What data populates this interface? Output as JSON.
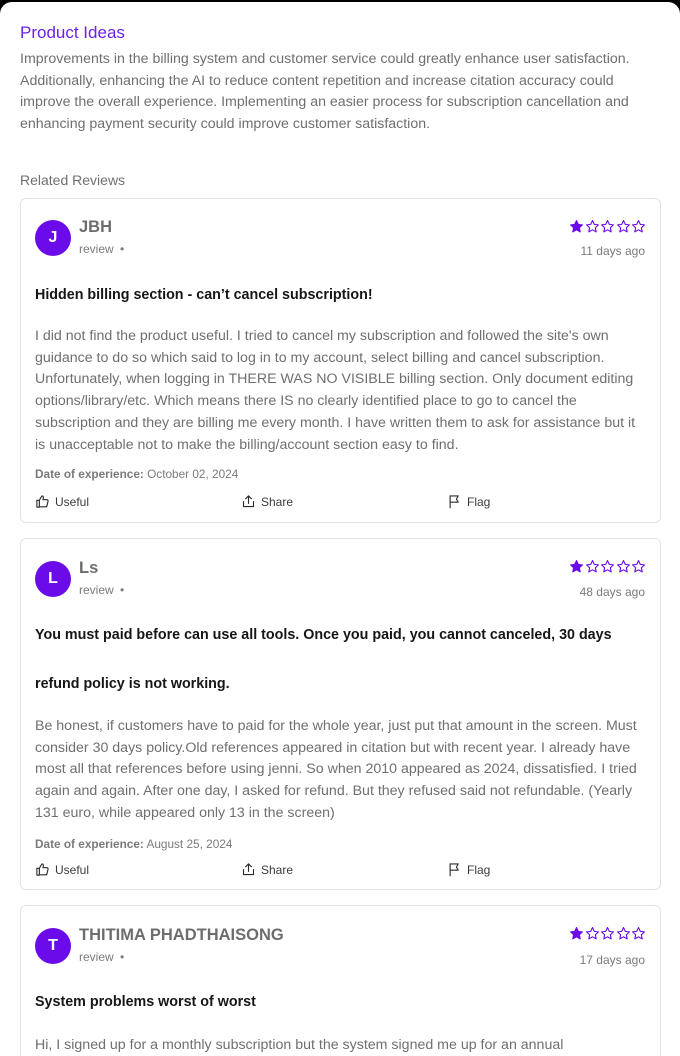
{
  "product_ideas": {
    "title": "Product Ideas",
    "text": "Improvements in the billing system and customer service could greatly enhance user satisfaction. Additionally, enhancing the AI to reduce content repetition and increase citation accuracy could improve the overall experience. Implementing an easier process for subscription cancellation and enhancing payment security could improve customer satisfaction."
  },
  "related_reviews": {
    "title": "Related Reviews",
    "colors": {
      "accent": "#6b0bea",
      "text_muted": "#6f6f6f"
    },
    "max_stars": 5,
    "actions": {
      "useful": "Useful",
      "share": "Share",
      "flag": "Flag"
    },
    "doe_label": "Date of experience:",
    "reviews": [
      {
        "initial": "J",
        "name": "JBH",
        "type": "review",
        "separator": "•",
        "rating": 1,
        "ago": "11 days ago",
        "title": "Hidden billing section - can’t cancel subscription!",
        "body": "I did not find the product useful. I tried to cancel my subscription and followed the site's own guidance to do so which said to log in to my account, select billing and cancel subscription. Unfortunately, when logging in THERE WAS NO VISIBLE billing section. Only document editing options/library/etc. Which means there IS no clearly identified place to go to cancel the subscription and they are billing me every month. I have written them to ask for assistance but it is unacceptable not to make the billing/account section easy to find.",
        "date": "October 02, 2024"
      },
      {
        "initial": "L",
        "name": "Ls",
        "type": "review",
        "separator": "•",
        "rating": 1,
        "ago": "48 days ago",
        "title": "You must paid before can use all tools. Once you paid, you cannot canceled, 30 days refund policy is not working.",
        "body": "Be honest, if customers have to paid for the whole year, just put that amount in the screen. Must consider 30 days policy.Old references appeared in citation but with recent year. I already have most all that references before using jenni. So when 2010 appeared as 2024, dissatisfied. I tried again and again. After one day, I asked for refund. But they refused said not refundable. (Yearly 131 euro, while appeared only 13 in the screen)",
        "date": "August 25, 2024"
      },
      {
        "initial": "T",
        "name": "THITIMA PHADTHAISONG",
        "type": "review",
        "separator": "•",
        "rating": 1,
        "ago": "17 days ago",
        "title": "System problems worst of worst",
        "body": "Hi, I signed up for a monthly subscription but the system signed me up for an annual"
      }
    ]
  }
}
